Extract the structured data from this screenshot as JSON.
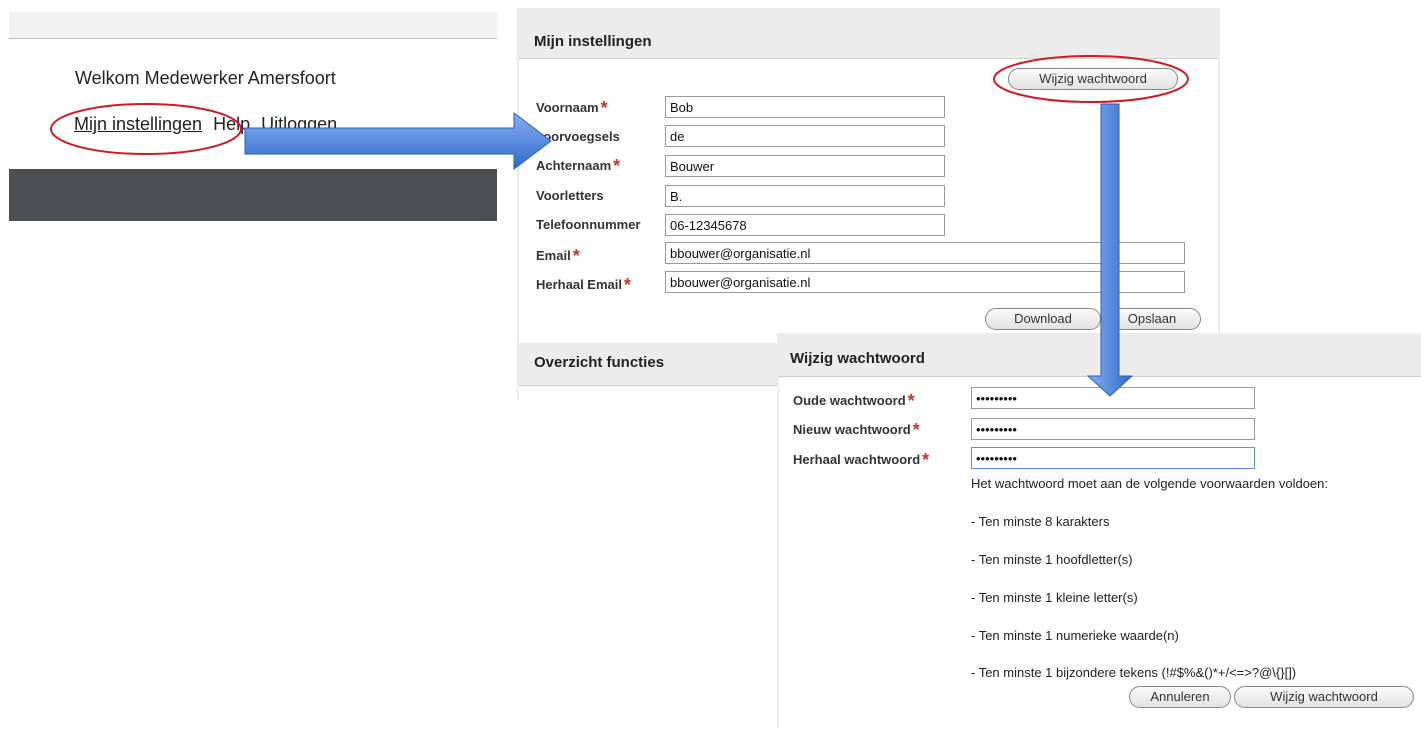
{
  "header": {
    "welcome": "Welkom Medewerker Amersfoort",
    "links": {
      "settings": "Mijn instellingen",
      "help": "Help",
      "logout": "Uitloggen"
    }
  },
  "settings": {
    "title": "Mijn instellingen",
    "change_password_button": "Wijzig wachtwoord",
    "fields": {
      "first_name": {
        "label": "Voornaam",
        "value": "Bob"
      },
      "prefix": {
        "label": "voorvoegsels",
        "value": "de"
      },
      "last_name": {
        "label": "Achternaam",
        "value": "Bouwer"
      },
      "initials": {
        "label": "Voorletters",
        "value": "B."
      },
      "phone": {
        "label": "Telefoonnummer",
        "value": "06-12345678"
      },
      "email": {
        "label": "Email",
        "value": "bbouwer@organisatie.nl"
      },
      "repeat_email": {
        "label": "Herhaal Email",
        "value": "bbouwer@organisatie.nl"
      }
    },
    "download_button": "Download",
    "save_button": "Opslaan",
    "overview_title": "Overzicht functies",
    "required_marker": "*"
  },
  "password_dialog": {
    "title": "Wijzig wachtwoord",
    "fields": {
      "old": {
        "label": "Oude wachtwoord",
        "value": "•••••••••"
      },
      "new": {
        "label": "Nieuw wachtwoord",
        "value": "•••••••••"
      },
      "repeat": {
        "label": "Herhaal wachtwoord",
        "value": "•••••••••"
      }
    },
    "requirements_intro": "Het wachtwoord moet aan de volgende voorwaarden voldoen:",
    "requirements": [
      "- Ten minste 8 karakters",
      "- Ten minste 1 hoofdletter(s)",
      "- Ten minste 1 kleine letter(s)",
      "- Ten minste 1 numerieke waarde(n)",
      "- Ten minste 1 bijzondere tekens (!#$%&()*+/<=>?@\\{}[])"
    ],
    "cancel_button": "Annuleren",
    "confirm_button": "Wijzig wachtwoord"
  },
  "colors": {
    "annotation_red": "#d01b22",
    "arrow_blue": "#3f7fd6",
    "required_red": "#c0392b",
    "dark_bar": "#4e4f51"
  }
}
